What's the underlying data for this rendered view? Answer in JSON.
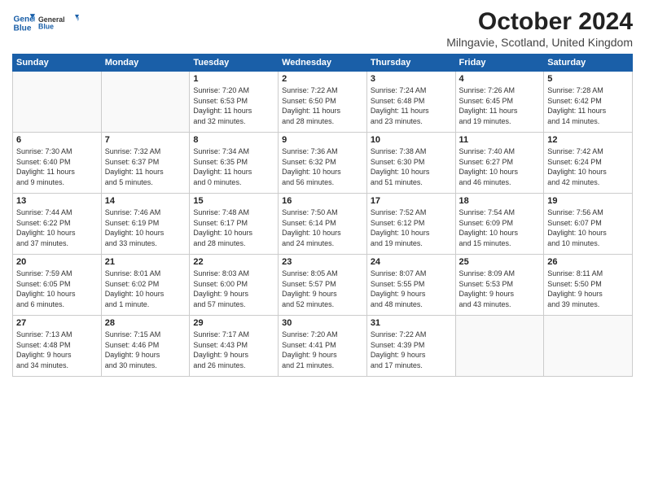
{
  "header": {
    "logo_line1": "General",
    "logo_line2": "Blue",
    "title": "October 2024",
    "subtitle": "Milngavie, Scotland, United Kingdom"
  },
  "weekdays": [
    "Sunday",
    "Monday",
    "Tuesday",
    "Wednesday",
    "Thursday",
    "Friday",
    "Saturday"
  ],
  "weeks": [
    [
      {
        "day": "",
        "info": ""
      },
      {
        "day": "",
        "info": ""
      },
      {
        "day": "1",
        "info": "Sunrise: 7:20 AM\nSunset: 6:53 PM\nDaylight: 11 hours\nand 32 minutes."
      },
      {
        "day": "2",
        "info": "Sunrise: 7:22 AM\nSunset: 6:50 PM\nDaylight: 11 hours\nand 28 minutes."
      },
      {
        "day": "3",
        "info": "Sunrise: 7:24 AM\nSunset: 6:48 PM\nDaylight: 11 hours\nand 23 minutes."
      },
      {
        "day": "4",
        "info": "Sunrise: 7:26 AM\nSunset: 6:45 PM\nDaylight: 11 hours\nand 19 minutes."
      },
      {
        "day": "5",
        "info": "Sunrise: 7:28 AM\nSunset: 6:42 PM\nDaylight: 11 hours\nand 14 minutes."
      }
    ],
    [
      {
        "day": "6",
        "info": "Sunrise: 7:30 AM\nSunset: 6:40 PM\nDaylight: 11 hours\nand 9 minutes."
      },
      {
        "day": "7",
        "info": "Sunrise: 7:32 AM\nSunset: 6:37 PM\nDaylight: 11 hours\nand 5 minutes."
      },
      {
        "day": "8",
        "info": "Sunrise: 7:34 AM\nSunset: 6:35 PM\nDaylight: 11 hours\nand 0 minutes."
      },
      {
        "day": "9",
        "info": "Sunrise: 7:36 AM\nSunset: 6:32 PM\nDaylight: 10 hours\nand 56 minutes."
      },
      {
        "day": "10",
        "info": "Sunrise: 7:38 AM\nSunset: 6:30 PM\nDaylight: 10 hours\nand 51 minutes."
      },
      {
        "day": "11",
        "info": "Sunrise: 7:40 AM\nSunset: 6:27 PM\nDaylight: 10 hours\nand 46 minutes."
      },
      {
        "day": "12",
        "info": "Sunrise: 7:42 AM\nSunset: 6:24 PM\nDaylight: 10 hours\nand 42 minutes."
      }
    ],
    [
      {
        "day": "13",
        "info": "Sunrise: 7:44 AM\nSunset: 6:22 PM\nDaylight: 10 hours\nand 37 minutes."
      },
      {
        "day": "14",
        "info": "Sunrise: 7:46 AM\nSunset: 6:19 PM\nDaylight: 10 hours\nand 33 minutes."
      },
      {
        "day": "15",
        "info": "Sunrise: 7:48 AM\nSunset: 6:17 PM\nDaylight: 10 hours\nand 28 minutes."
      },
      {
        "day": "16",
        "info": "Sunrise: 7:50 AM\nSunset: 6:14 PM\nDaylight: 10 hours\nand 24 minutes."
      },
      {
        "day": "17",
        "info": "Sunrise: 7:52 AM\nSunset: 6:12 PM\nDaylight: 10 hours\nand 19 minutes."
      },
      {
        "day": "18",
        "info": "Sunrise: 7:54 AM\nSunset: 6:09 PM\nDaylight: 10 hours\nand 15 minutes."
      },
      {
        "day": "19",
        "info": "Sunrise: 7:56 AM\nSunset: 6:07 PM\nDaylight: 10 hours\nand 10 minutes."
      }
    ],
    [
      {
        "day": "20",
        "info": "Sunrise: 7:59 AM\nSunset: 6:05 PM\nDaylight: 10 hours\nand 6 minutes."
      },
      {
        "day": "21",
        "info": "Sunrise: 8:01 AM\nSunset: 6:02 PM\nDaylight: 10 hours\nand 1 minute."
      },
      {
        "day": "22",
        "info": "Sunrise: 8:03 AM\nSunset: 6:00 PM\nDaylight: 9 hours\nand 57 minutes."
      },
      {
        "day": "23",
        "info": "Sunrise: 8:05 AM\nSunset: 5:57 PM\nDaylight: 9 hours\nand 52 minutes."
      },
      {
        "day": "24",
        "info": "Sunrise: 8:07 AM\nSunset: 5:55 PM\nDaylight: 9 hours\nand 48 minutes."
      },
      {
        "day": "25",
        "info": "Sunrise: 8:09 AM\nSunset: 5:53 PM\nDaylight: 9 hours\nand 43 minutes."
      },
      {
        "day": "26",
        "info": "Sunrise: 8:11 AM\nSunset: 5:50 PM\nDaylight: 9 hours\nand 39 minutes."
      }
    ],
    [
      {
        "day": "27",
        "info": "Sunrise: 7:13 AM\nSunset: 4:48 PM\nDaylight: 9 hours\nand 34 minutes."
      },
      {
        "day": "28",
        "info": "Sunrise: 7:15 AM\nSunset: 4:46 PM\nDaylight: 9 hours\nand 30 minutes."
      },
      {
        "day": "29",
        "info": "Sunrise: 7:17 AM\nSunset: 4:43 PM\nDaylight: 9 hours\nand 26 minutes."
      },
      {
        "day": "30",
        "info": "Sunrise: 7:20 AM\nSunset: 4:41 PM\nDaylight: 9 hours\nand 21 minutes."
      },
      {
        "day": "31",
        "info": "Sunrise: 7:22 AM\nSunset: 4:39 PM\nDaylight: 9 hours\nand 17 minutes."
      },
      {
        "day": "",
        "info": ""
      },
      {
        "day": "",
        "info": ""
      }
    ]
  ]
}
